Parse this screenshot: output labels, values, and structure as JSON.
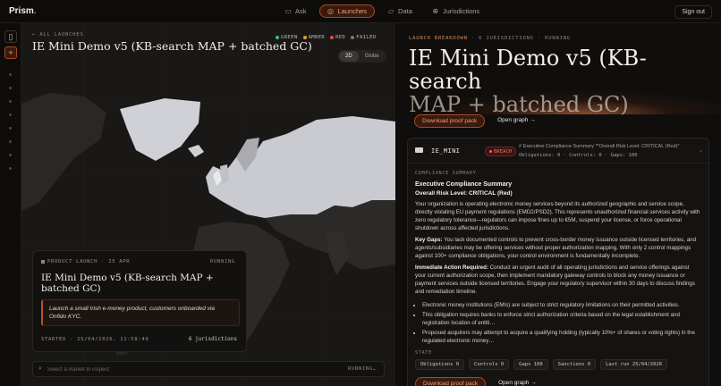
{
  "app": {
    "brand": "Prism",
    "brand_dot": "."
  },
  "nav": {
    "items": [
      {
        "label": "Ask",
        "icon": "chat-icon",
        "active": false
      },
      {
        "label": "Launches",
        "icon": "rocket-icon",
        "active": true
      },
      {
        "label": "Data",
        "icon": "folder-icon",
        "active": false
      },
      {
        "label": "Jurisdictions",
        "icon": "globe-icon",
        "active": false
      }
    ],
    "sign_out": "Sign out"
  },
  "map_panel": {
    "back_label": "← ALL LAUNCHES",
    "title": "IE Mini Demo v5 (KB-search MAP + batched GC)",
    "legend": [
      {
        "label": "GREEN",
        "color": "#3fbf6a"
      },
      {
        "label": "AMBER",
        "color": "#e0a23a"
      },
      {
        "label": "RED",
        "color": "#e04a3a"
      },
      {
        "label": "FAILED",
        "color": "#7a7a7a"
      }
    ],
    "view_toggle": {
      "options": [
        "2D",
        "Globe"
      ],
      "selected": "2D"
    },
    "card": {
      "meta": "PRODUCT LAUNCH · 25 APR",
      "status": "RUNNING",
      "title": "IE Mini Demo v5 (KB-search MAP + batched GC)",
      "description": "Launch a small Irish e-money product, customers onboarded via Onfido KYC.",
      "started": "STARTED · 25/04/2026, 11:58:49",
      "jurisdictions": "6 jurisdictions"
    },
    "search": {
      "placeholder": "Select a market to inspect",
      "status": "RUNNING…"
    }
  },
  "right_panel": {
    "breadcrumb": {
      "prefix": "LAUNCH BREAKDOWN",
      "jurisdictions": "6 JURISDICTIONS",
      "status": "RUNNING"
    },
    "title_line1": "IE Mini Demo v5 (KB-search",
    "title_line2": "MAP + batched GC)",
    "actions": {
      "proof_pack": "Download proof pack",
      "open_graph": "Open graph →"
    },
    "jurisdiction": {
      "code": "IE_MINI",
      "badge": "BREACH",
      "summary_line1": "# Executive Compliance Summary **Overall Risk Level: CRITICAL (Red)*",
      "summary_line2": "Obligations: 0 · Controls: 0 · Gaps: 100",
      "section_label": "COMPLIANCE SUMMARY",
      "heading": "Executive Compliance Summary",
      "risk_level": "Overall Risk Level: CRITICAL (Red)",
      "para1": "Your organization is operating electronic money services beyond its authorized geographic and service scope, directly violating EU payment regulations (EMD2/PSD2). This represents unauthorized financial services activity with zero regulatory tolerance—regulators can impose fines up to €5M, suspend your license, or force operational shutdown across affected jurisdictions.",
      "gaps_label": "Key Gaps:",
      "gaps_text": " You lack documented controls to prevent cross-border money issuance outside licensed territories, and agents/subsidiaries may be offering services without proper authorization mapping. With only 2 control mappings against 100+ compliance obligations, your control environment is fundamentally incomplete.",
      "action_label": "Immediate Action Required:",
      "action_text": " Conduct an urgent audit of all operating jurisdictions and service offerings against your current authorization scope, then implement mandatory gateway controls to block any money issuance or payment services outside licensed territories. Engage your regulatory supervisor within 30 days to discuss findings and remediation timeline.",
      "bullets": [
        "Electronic money institutions (EMIs) are subject to strict regulatory limitations on their permitted activities.",
        "This obligation requires banks to enforce strict authorization criteria based on the legal establishment and registration location of entiti…",
        "Proposed acquirers may attempt to acquire a qualifying holding (typically 10%+ of shares or voting rights) in the regulated electronic money…"
      ],
      "state_label": "STATE",
      "state_chips": [
        "Obligations 0",
        "Controls 0",
        "Gaps 100",
        "Sanctions 0",
        "Last run 25/04/2026"
      ]
    }
  }
}
